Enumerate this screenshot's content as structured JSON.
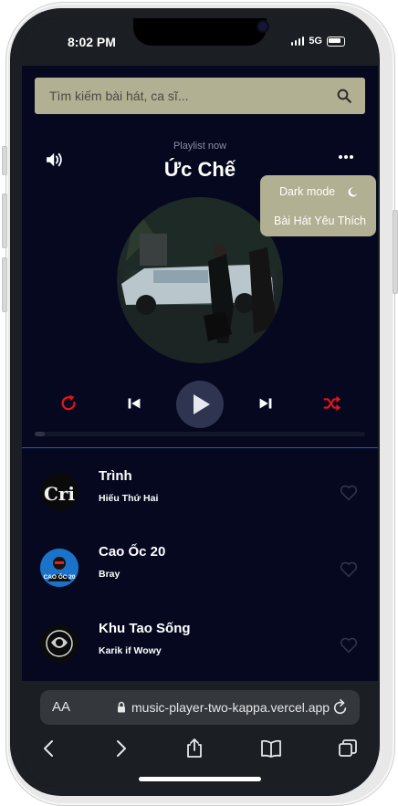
{
  "status": {
    "time": "8:02 PM",
    "network": "5G"
  },
  "search": {
    "placeholder": "Tìm kiếm bài hát, ca sĩ..."
  },
  "player": {
    "label": "Playlist now",
    "title": "Ức Chế",
    "progress": 0.03
  },
  "menu": {
    "dark_mode": "Dark mode",
    "favorites": "Bài Hát Yêu Thích"
  },
  "songs": [
    {
      "title": "Trình",
      "artist": "Hiếu Thứ Hai",
      "thumb_text": "Cri"
    },
    {
      "title": "Cao Ốc 20",
      "artist": "Bray",
      "thumb_text": "CAO ỐC 20"
    },
    {
      "title": "Khu Tao Sống",
      "artist": "Karik if Wowy"
    }
  ],
  "browser": {
    "aa": "AA",
    "url": "music-player-two-kappa.vercel.app"
  },
  "colors": {
    "background": "#05081f",
    "accent_control": "#e0161d",
    "menu_bg": "#b1b092",
    "divider": "#2f52b8"
  },
  "icons": [
    "volume-icon",
    "more-icon",
    "moon-icon",
    "repeat-icon",
    "prev-icon",
    "play-icon",
    "next-icon",
    "shuffle-icon",
    "heart-icon",
    "search-icon",
    "lock-icon",
    "reload-icon",
    "back-icon",
    "forward-icon",
    "share-icon",
    "bookmarks-icon",
    "tabs-icon"
  ]
}
